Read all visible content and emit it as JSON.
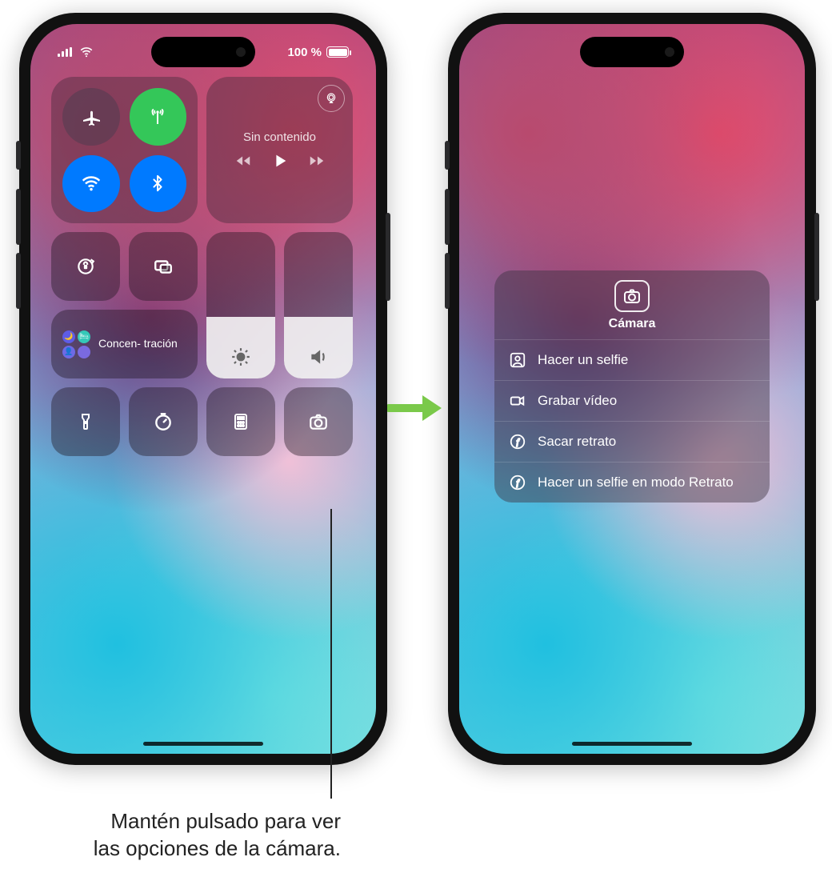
{
  "status": {
    "battery_text": "100 %"
  },
  "media": {
    "now_playing": "Sin contenido"
  },
  "focus": {
    "label": "Concen-\ntración"
  },
  "cam_popup": {
    "title": "Cámara",
    "items": [
      "Hacer un selfie",
      "Grabar vídeo",
      "Sacar retrato",
      "Hacer un selfie en modo Retrato"
    ]
  },
  "callout": "Mantén pulsado para ver\nlas opciones de la cámara."
}
